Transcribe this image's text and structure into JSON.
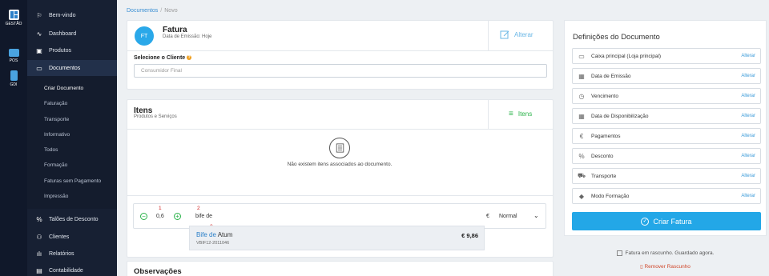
{
  "rail": [
    {
      "label": "GESTÃO",
      "icon": "grid-icon"
    },
    {
      "label": "POS",
      "icon": "monitor-icon"
    },
    {
      "label": "GDI",
      "icon": "device-icon"
    }
  ],
  "sidebar": {
    "items": [
      {
        "label": "Bem-vindo",
        "icon": "flag-icon"
      },
      {
        "label": "Dashboard",
        "icon": "activity-icon"
      },
      {
        "label": "Produtos",
        "icon": "box-icon"
      },
      {
        "label": "Documentos",
        "icon": "folder-icon"
      }
    ],
    "sub_items": [
      "Criar Documento",
      "Faturação",
      "Transporte",
      "Informativo",
      "Todos",
      "Formação",
      "Faturas sem Pagamento",
      "Impressão"
    ],
    "bottom_items": [
      {
        "label": "Talões de Desconto",
        "icon": "percent-icon"
      },
      {
        "label": "Clientes",
        "icon": "users-icon"
      },
      {
        "label": "Relatórios",
        "icon": "bar-chart-icon"
      },
      {
        "label": "Contabilidade",
        "icon": "document-icon"
      }
    ]
  },
  "breadcrumb": {
    "link": "Documentos",
    "separator": "/",
    "current": "Novo"
  },
  "document": {
    "avatar": "FT",
    "title": "Fatura",
    "subtitle": "Data de Emissão: Hoje",
    "alter_label": "Alterar",
    "client_label": "Selecione o Cliente",
    "client_help": "?",
    "client_placeholder": "Consumidor Final"
  },
  "items": {
    "title": "Itens",
    "subtitle": "Produtos e Serviços",
    "button_label": "Itens",
    "empty_message": "Não existem itens associados ao documento."
  },
  "line": {
    "annotations": [
      "1",
      "2",
      "3"
    ],
    "quantity": "0,6",
    "description": "bife de",
    "currency": "€",
    "price_type": "Normal"
  },
  "suggestion": {
    "name_match": "Bife de",
    "name_rest": " Atum",
    "ref": "VBIF12-2011046",
    "price": "€ 9,86"
  },
  "notes": {
    "title": "Observações"
  },
  "definitions": {
    "title": "Definições do Documento",
    "link_label": "Alterar",
    "rows": [
      {
        "label": "Caixa principal (Loja principal)",
        "icon": "cash-register-icon"
      },
      {
        "label": "Data de Emissão",
        "icon": "calendar-icon"
      },
      {
        "label": "Vencimento",
        "icon": "clock-icon"
      },
      {
        "label": "Data de Disponibilização",
        "icon": "calendar-icon"
      },
      {
        "label": "Pagamentos",
        "icon": "euro-icon"
      },
      {
        "label": "Desconto",
        "icon": "discount-icon"
      },
      {
        "label": "Transporte",
        "icon": "truck-icon"
      },
      {
        "label": "Modo Formação",
        "icon": "graduation-cap-icon"
      }
    ],
    "create_label": "Criar Fatura",
    "draft_note": "Fatura em rascunho. Guardado agora.",
    "remove_draft": "Remover Rascunho"
  },
  "colors": {
    "accent": "#23a7e7",
    "sidebar": "#172033",
    "rail": "#10182a",
    "green": "#2bb34a",
    "link": "#3a9ad9"
  }
}
